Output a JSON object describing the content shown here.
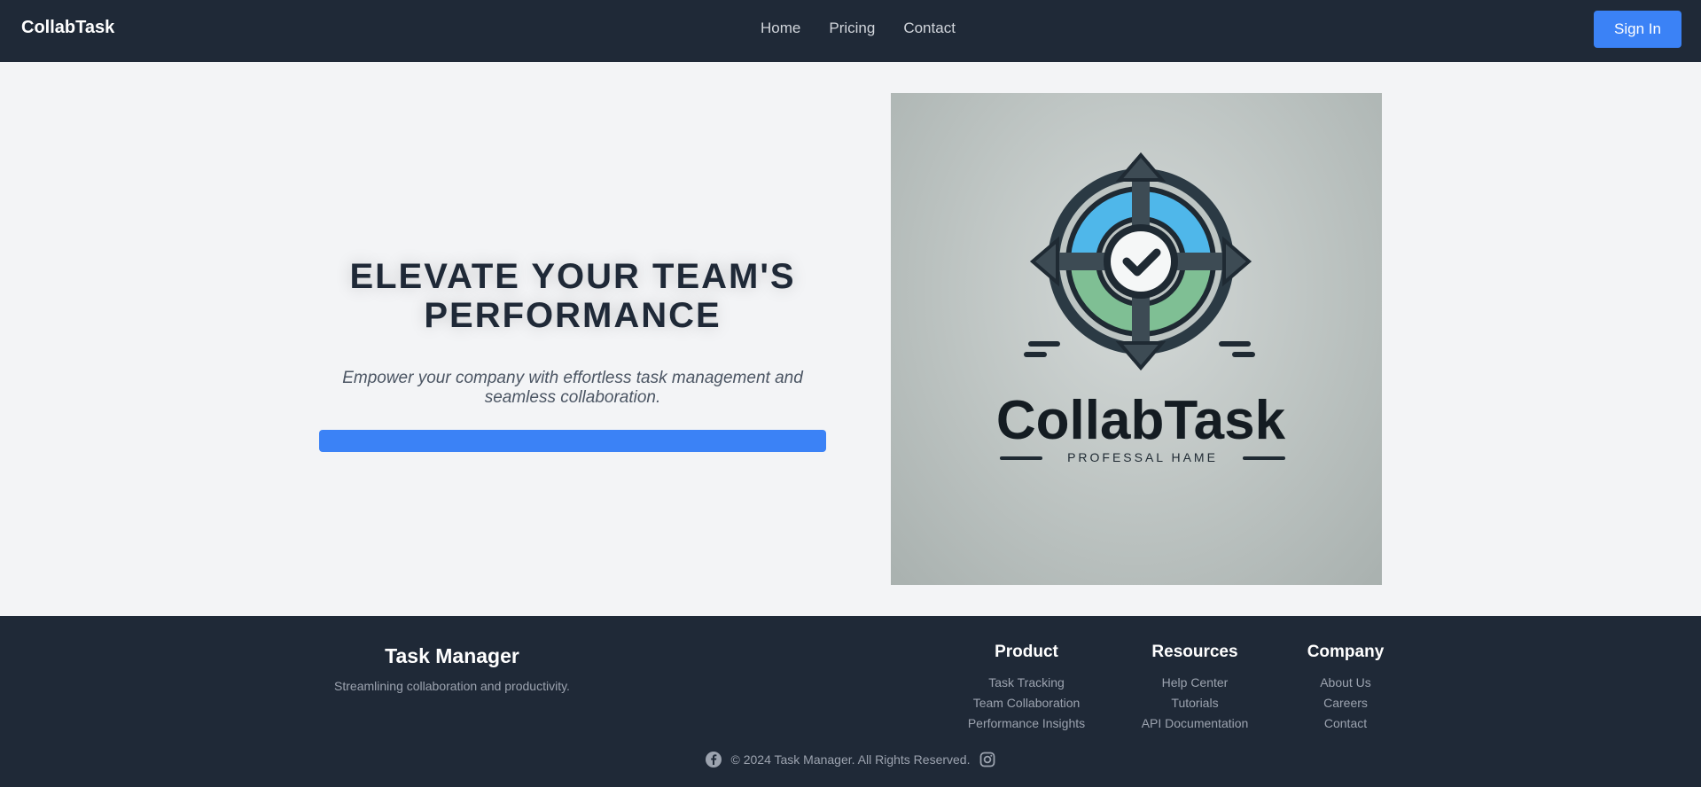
{
  "nav": {
    "brand": "CollabTask",
    "links": [
      "Home",
      "Pricing",
      "Contact"
    ],
    "signin_label": "Sign In"
  },
  "hero": {
    "title": "ELEVATE YOUR TEAM'S PERFORMANCE",
    "subtitle": "Empower your company with effortless task management and seamless collaboration.",
    "logo_text": "CollabTask",
    "logo_tagline": "PROFESSAL HAME"
  },
  "footer": {
    "title": "Task Manager",
    "tagline": "Streamlining collaboration and productivity.",
    "columns": [
      {
        "title": "Product",
        "links": [
          "Task Tracking",
          "Team Collaboration",
          "Performance Insights"
        ]
      },
      {
        "title": "Resources",
        "links": [
          "Help Center",
          "Tutorials",
          "API Documentation"
        ]
      },
      {
        "title": "Company",
        "links": [
          "About Us",
          "Careers",
          "Contact"
        ]
      }
    ],
    "copyright": "© 2024 Task Manager. All Rights Reserved.",
    "social_icons": [
      "facebook-icon",
      "instagram-icon"
    ]
  },
  "colors": {
    "navbar_bg": "#1f2937",
    "accent": "#3b82f6",
    "page_bg": "#f3f4f6"
  }
}
